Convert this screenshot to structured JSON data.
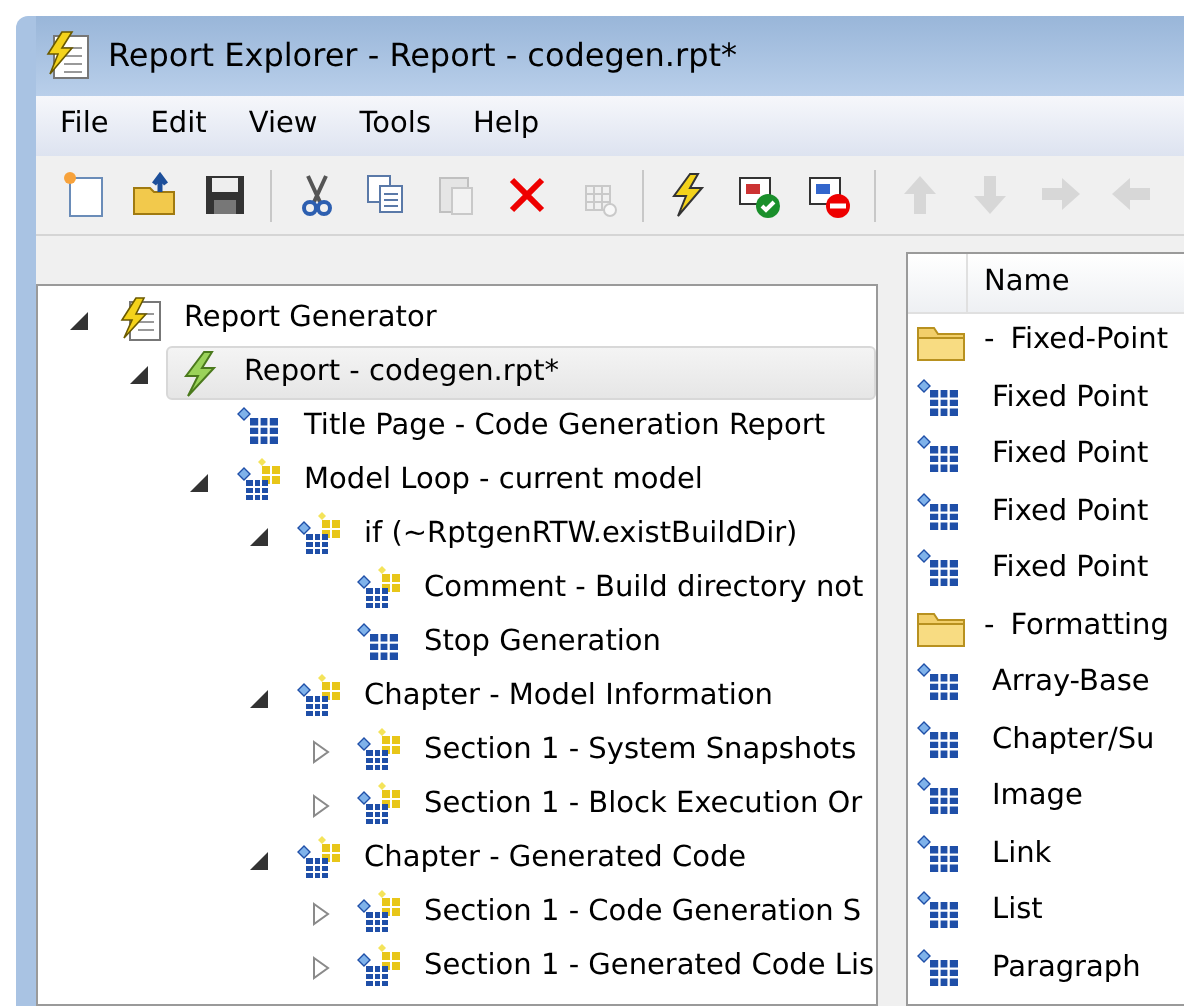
{
  "window": {
    "title": "Report Explorer - Report - codegen.rpt*"
  },
  "menu": [
    "File",
    "Edit",
    "View",
    "Tools",
    "Help"
  ],
  "toolbar": [
    {
      "kind": "new",
      "disabled": false
    },
    {
      "kind": "open",
      "disabled": false
    },
    {
      "kind": "save",
      "disabled": false
    },
    {
      "kind": "separator"
    },
    {
      "kind": "cut",
      "disabled": false
    },
    {
      "kind": "copy",
      "disabled": false
    },
    {
      "kind": "paste",
      "disabled": true
    },
    {
      "kind": "delete",
      "disabled": false
    },
    {
      "kind": "grid",
      "disabled": true
    },
    {
      "kind": "separator"
    },
    {
      "kind": "lightning",
      "disabled": false
    },
    {
      "kind": "activate",
      "disabled": false
    },
    {
      "kind": "deactivate",
      "disabled": false
    },
    {
      "kind": "separator"
    },
    {
      "kind": "up",
      "disabled": true
    },
    {
      "kind": "down",
      "disabled": true
    },
    {
      "kind": "right",
      "disabled": true
    },
    {
      "kind": "left",
      "disabled": true
    }
  ],
  "tree": [
    {
      "label": "Report Generator",
      "kind": "generator",
      "expanded": true,
      "selected": false,
      "children": [
        {
          "label": "Report - codegen.rpt*",
          "kind": "report",
          "expanded": true,
          "selected": true,
          "children": [
            {
              "label": "Title Page - Code Generation Report",
              "kind": "component",
              "selected": false
            },
            {
              "label": "Model Loop - current model",
              "kind": "group",
              "expanded": true,
              "selected": false,
              "children": [
                {
                  "label": "if (~RptgenRTW.existBuildDir)",
                  "kind": "group",
                  "expanded": true,
                  "selected": false,
                  "children": [
                    {
                      "label": "Comment - Build directory not",
                      "kind": "group",
                      "selected": false
                    },
                    {
                      "label": "Stop Generation",
                      "kind": "component",
                      "selected": false
                    }
                  ]
                },
                {
                  "label": "Chapter - Model Information",
                  "kind": "group",
                  "expanded": true,
                  "selected": false,
                  "children": [
                    {
                      "label": "Section 1 - System Snapshots",
                      "kind": "group",
                      "expanded": false,
                      "selected": false
                    },
                    {
                      "label": "Section 1 - Block Execution Or",
                      "kind": "group",
                      "expanded": false,
                      "selected": false
                    }
                  ]
                },
                {
                  "label": "Chapter - Generated Code",
                  "kind": "group",
                  "expanded": true,
                  "selected": false,
                  "children": [
                    {
                      "label": "Section 1 - Code Generation S",
                      "kind": "group",
                      "expanded": false,
                      "selected": false
                    },
                    {
                      "label": "Section 1 - Generated Code Lis",
                      "kind": "group",
                      "expanded": false,
                      "selected": false
                    }
                  ]
                }
              ]
            }
          ]
        }
      ]
    }
  ],
  "library": {
    "columns": [
      "Name"
    ],
    "rows": [
      {
        "kind": "folder",
        "prefix": "-",
        "label": "Fixed-Point"
      },
      {
        "kind": "component",
        "label": "Fixed Point"
      },
      {
        "kind": "component",
        "label": "Fixed Point"
      },
      {
        "kind": "component",
        "label": "Fixed Point"
      },
      {
        "kind": "component",
        "label": "Fixed Point"
      },
      {
        "kind": "folder",
        "prefix": "-",
        "label": "Formatting"
      },
      {
        "kind": "component",
        "label": "Array-Base"
      },
      {
        "kind": "component",
        "label": "Chapter/Su"
      },
      {
        "kind": "component",
        "label": "Image"
      },
      {
        "kind": "component",
        "label": "Link"
      },
      {
        "kind": "component",
        "label": "List"
      },
      {
        "kind": "component",
        "label": "Paragraph"
      }
    ]
  }
}
